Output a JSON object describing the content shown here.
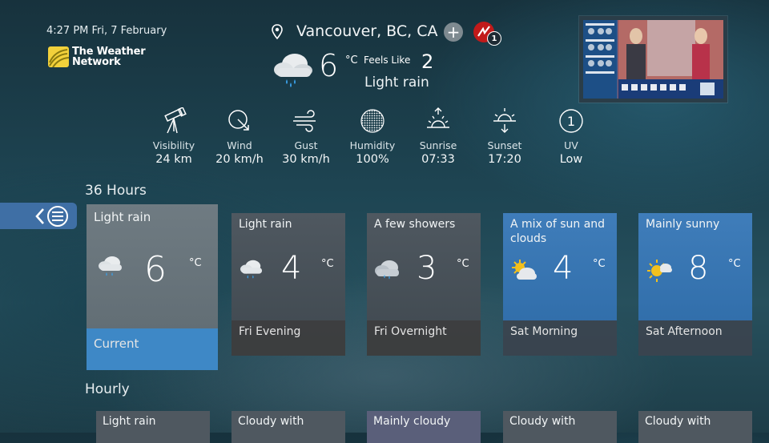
{
  "header": {
    "datetime": "4:27 PM Fri, 7 February",
    "logo_line1": "The Weather",
    "logo_line2": "Network",
    "location": "Vancouver, BC, CA",
    "add_label": "+",
    "alert_count": "1"
  },
  "current": {
    "temp": "6",
    "unit": "°C",
    "feels_like_label": "Feels Like",
    "feels_like_value": "2",
    "condition": "Light rain",
    "icon": "rain-cloud-icon"
  },
  "stats": [
    {
      "label": "Visibility",
      "value": "24 km",
      "icon": "telescope-icon"
    },
    {
      "label": "Wind",
      "value": "20 km/h",
      "icon": "wind-direction-icon"
    },
    {
      "label": "Gust",
      "value": "30 km/h",
      "icon": "gust-icon"
    },
    {
      "label": "Humidity",
      "value": "100%",
      "icon": "humidity-icon"
    },
    {
      "label": "Sunrise",
      "value": "07:33",
      "icon": "sunrise-icon"
    },
    {
      "label": "Sunset",
      "value": "17:20",
      "icon": "sunset-icon"
    },
    {
      "label": "UV",
      "value": "Low",
      "icon": "uv-icon",
      "uv_index": "1"
    }
  ],
  "sections": {
    "hours36": "36 Hours",
    "hourly": "Hourly"
  },
  "forecast": [
    {
      "title": "Light rain",
      "temp": "6",
      "unit": "°C",
      "period": "Current",
      "icon": "rain-cloud-icon"
    },
    {
      "title": "Light rain",
      "temp": "4",
      "unit": "°C",
      "period": "Fri  Evening",
      "icon": "rain-cloud-icon"
    },
    {
      "title": "A few showers",
      "temp": "3",
      "unit": "°C",
      "period": "Fri  Overnight",
      "icon": "showers-icon"
    },
    {
      "title": "A mix of sun and clouds",
      "temp": "4",
      "unit": "°C",
      "period": "Sat  Morning",
      "icon": "sun-cloud-icon"
    },
    {
      "title": "Mainly sunny",
      "temp": "8",
      "unit": "°C",
      "period": "Sat  Afternoon",
      "icon": "mostly-sunny-icon"
    }
  ],
  "hourly": [
    {
      "title": "Light rain"
    },
    {
      "title": "Cloudy with"
    },
    {
      "title": "Mainly cloudy"
    },
    {
      "title": "Cloudy with"
    },
    {
      "title": "Cloudy with"
    }
  ],
  "colors": {
    "accent_blue": "#3e88c6",
    "alert_red": "#c11a1a",
    "logo_yellow": "#f2d13b"
  }
}
